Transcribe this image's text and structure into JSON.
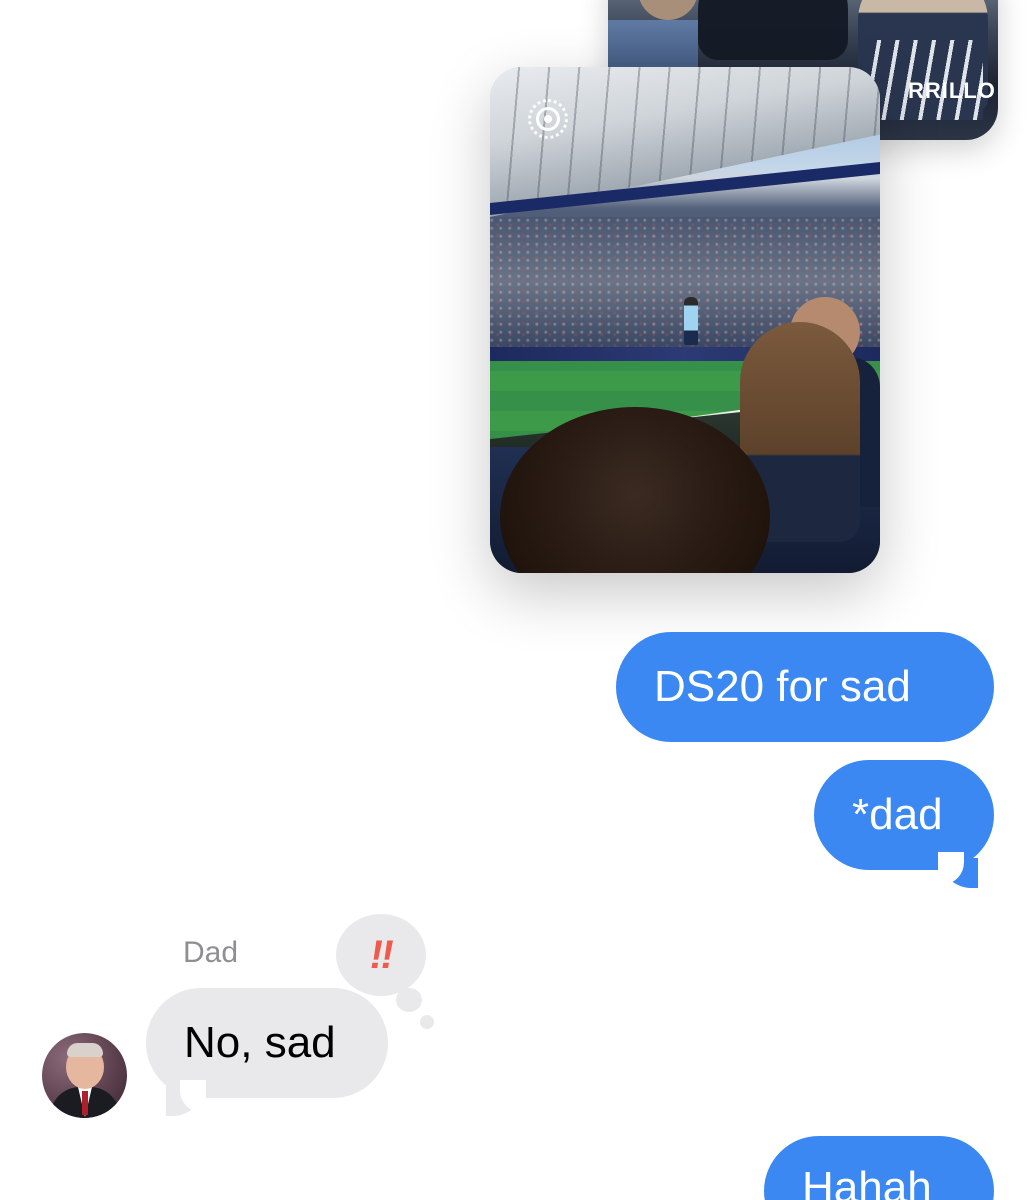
{
  "conversation": {
    "attachments": [
      {
        "type": "photo",
        "description_label": "stadium-photo-back",
        "overlay_text": "RRILLO"
      },
      {
        "type": "live-photo",
        "description_label": "stadium-photo-front",
        "live_badge_icon": "live-photo-icon"
      }
    ],
    "messages": [
      {
        "direction": "sent",
        "text": "DS20 for sad"
      },
      {
        "direction": "sent",
        "text": "*dad"
      },
      {
        "direction": "received",
        "sender": "Dad",
        "text": "No, sad",
        "tapback": "‼"
      },
      {
        "direction": "sent",
        "text": "Hahah"
      }
    ]
  },
  "colors": {
    "sent_bubble": "#3b88f2",
    "received_bubble": "#e9e9eb",
    "sender_name": "#8e8e93",
    "tapback_glyph": "#ef5a4a"
  }
}
